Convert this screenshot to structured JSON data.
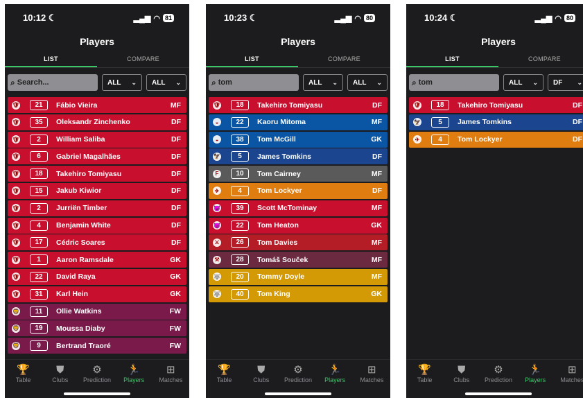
{
  "screens": [
    {
      "time": "10:12",
      "battery": "81",
      "title": "Players",
      "tabs": [
        "LIST",
        "COMPARE"
      ],
      "search": {
        "value": "",
        "placeholder": "Search..."
      },
      "filter_club": "ALL",
      "filter_pos": "ALL",
      "rows": [
        {
          "num": "21",
          "name": "Fábio Vieira",
          "pos": "MF",
          "color": "#c8102e",
          "crest": "🛡"
        },
        {
          "num": "35",
          "name": "Oleksandr Zinchenko",
          "pos": "DF",
          "color": "#c8102e",
          "crest": "🛡"
        },
        {
          "num": "2",
          "name": "William Saliba",
          "pos": "DF",
          "color": "#c8102e",
          "crest": "🛡"
        },
        {
          "num": "6",
          "name": "Gabriel Magalhães",
          "pos": "DF",
          "color": "#c8102e",
          "crest": "🛡"
        },
        {
          "num": "18",
          "name": "Takehiro Tomiyasu",
          "pos": "DF",
          "color": "#c8102e",
          "crest": "🛡"
        },
        {
          "num": "15",
          "name": "Jakub Kiwior",
          "pos": "DF",
          "color": "#c8102e",
          "crest": "🛡"
        },
        {
          "num": "2",
          "name": "Jurriën Timber",
          "pos": "DF",
          "color": "#c8102e",
          "crest": "🛡"
        },
        {
          "num": "4",
          "name": "Benjamin White",
          "pos": "DF",
          "color": "#c8102e",
          "crest": "🛡"
        },
        {
          "num": "17",
          "name": "Cédric Soares",
          "pos": "DF",
          "color": "#c8102e",
          "crest": "🛡"
        },
        {
          "num": "1",
          "name": "Aaron Ramsdale",
          "pos": "GK",
          "color": "#c8102e",
          "crest": "🛡"
        },
        {
          "num": "22",
          "name": "David Raya",
          "pos": "GK",
          "color": "#c8102e",
          "crest": "🛡"
        },
        {
          "num": "31",
          "name": "Karl Hein",
          "pos": "GK",
          "color": "#c8102e",
          "crest": "🛡"
        },
        {
          "num": "11",
          "name": "Ollie Watkins",
          "pos": "FW",
          "color": "#7a1a4a",
          "crest": "🦁"
        },
        {
          "num": "19",
          "name": "Moussa Diaby",
          "pos": "FW",
          "color": "#7a1a4a",
          "crest": "🦁"
        },
        {
          "num": "9",
          "name": "Bertrand Traoré",
          "pos": "FW",
          "color": "#7a1a4a",
          "crest": "🦁"
        }
      ]
    },
    {
      "time": "10:23",
      "battery": "80",
      "title": "Players",
      "tabs": [
        "LIST",
        "COMPARE"
      ],
      "search": {
        "value": "tom",
        "placeholder": "Search..."
      },
      "filter_club": "ALL",
      "filter_pos": "ALL",
      "rows": [
        {
          "num": "18",
          "name": "Takehiro Tomiyasu",
          "pos": "DF",
          "color": "#c8102e",
          "crest": "🛡"
        },
        {
          "num": "22",
          "name": "Kaoru Mitoma",
          "pos": "MF",
          "color": "#0b56a4",
          "crest": "◒"
        },
        {
          "num": "38",
          "name": "Tom McGill",
          "pos": "GK",
          "color": "#0b56a4",
          "crest": "◒"
        },
        {
          "num": "5",
          "name": "James Tomkins",
          "pos": "DF",
          "color": "#1b458f",
          "crest": "🦅"
        },
        {
          "num": "10",
          "name": "Tom Cairney",
          "pos": "MF",
          "color": "#5a5a5a",
          "crest": "F"
        },
        {
          "num": "4",
          "name": "Tom Lockyer",
          "pos": "DF",
          "color": "#e07d10",
          "crest": "✈"
        },
        {
          "num": "39",
          "name": "Scott McTominay",
          "pos": "MF",
          "color": "#c8102e",
          "crest": "😈"
        },
        {
          "num": "22",
          "name": "Tom Heaton",
          "pos": "GK",
          "color": "#c8102e",
          "crest": "😈"
        },
        {
          "num": "26",
          "name": "Tom Davies",
          "pos": "MF",
          "color": "#b41d26",
          "crest": "⚔"
        },
        {
          "num": "28",
          "name": "Tomáš Souček",
          "pos": "MF",
          "color": "#6b2a3f",
          "crest": "⚒"
        },
        {
          "num": "20",
          "name": "Tommy Doyle",
          "pos": "MF",
          "color": "#d39a06",
          "crest": "🐺"
        },
        {
          "num": "40",
          "name": "Tom King",
          "pos": "GK",
          "color": "#d39a06",
          "crest": "🐺"
        }
      ]
    },
    {
      "time": "10:24",
      "battery": "80",
      "title": "Players",
      "tabs": [
        "LIST",
        "COMPARE"
      ],
      "search": {
        "value": "tom",
        "placeholder": "Search..."
      },
      "filter_club": "ALL",
      "filter_pos": "DF",
      "rows": [
        {
          "num": "18",
          "name": "Takehiro Tomiyasu",
          "pos": "DF",
          "color": "#c8102e",
          "crest": "🛡"
        },
        {
          "num": "5",
          "name": "James Tomkins",
          "pos": "DF",
          "color": "#1b458f",
          "crest": "🦅"
        },
        {
          "num": "4",
          "name": "Tom Lockyer",
          "pos": "DF",
          "color": "#e07d10",
          "crest": "✈"
        }
      ]
    }
  ],
  "nav": [
    {
      "label": "Table",
      "icon": "trophy-icon",
      "glyph": "🏆"
    },
    {
      "label": "Clubs",
      "icon": "shield-icon",
      "glyph": "⛊"
    },
    {
      "label": "Prediction",
      "icon": "brain-icon",
      "glyph": "⚙"
    },
    {
      "label": "Players",
      "icon": "player-icon",
      "glyph": "🏃"
    },
    {
      "label": "Matches",
      "icon": "pitch-icon",
      "glyph": "⊞"
    }
  ],
  "active_nav": "Players",
  "accent": "#3cc66a"
}
